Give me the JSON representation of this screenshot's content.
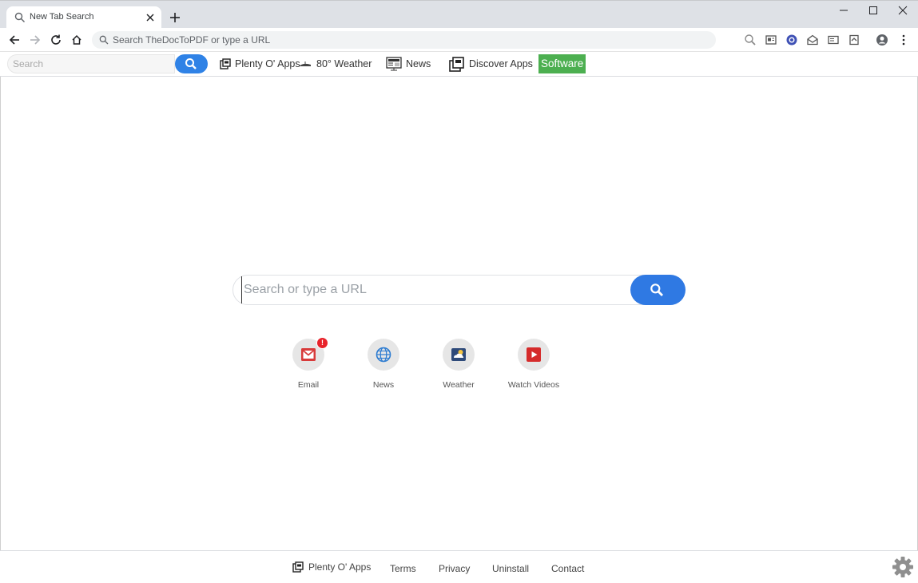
{
  "tab": {
    "title": "New Tab Search",
    "icon": "search-icon"
  },
  "omnibox": {
    "placeholder": "Search TheDocToPDF or type a URL"
  },
  "extension_bar": {
    "search_placeholder": "Search",
    "links": {
      "plenty": "Plenty O' Apps",
      "weather": "80° Weather",
      "news": "News",
      "discover": "Discover Apps"
    },
    "software_label": "Software",
    "software_color": "#4caf50"
  },
  "main": {
    "search_placeholder": "Search or type a URL",
    "search_button_color": "#2f79e3",
    "shortcuts": {
      "email": "Email",
      "news": "News",
      "weather": "Weather",
      "videos": "Watch Videos"
    },
    "email_badge": "!"
  },
  "footer": {
    "plenty": "Plenty O' Apps",
    "terms": "Terms",
    "privacy": "Privacy",
    "uninstall": "Uninstall",
    "contact": "Contact"
  }
}
